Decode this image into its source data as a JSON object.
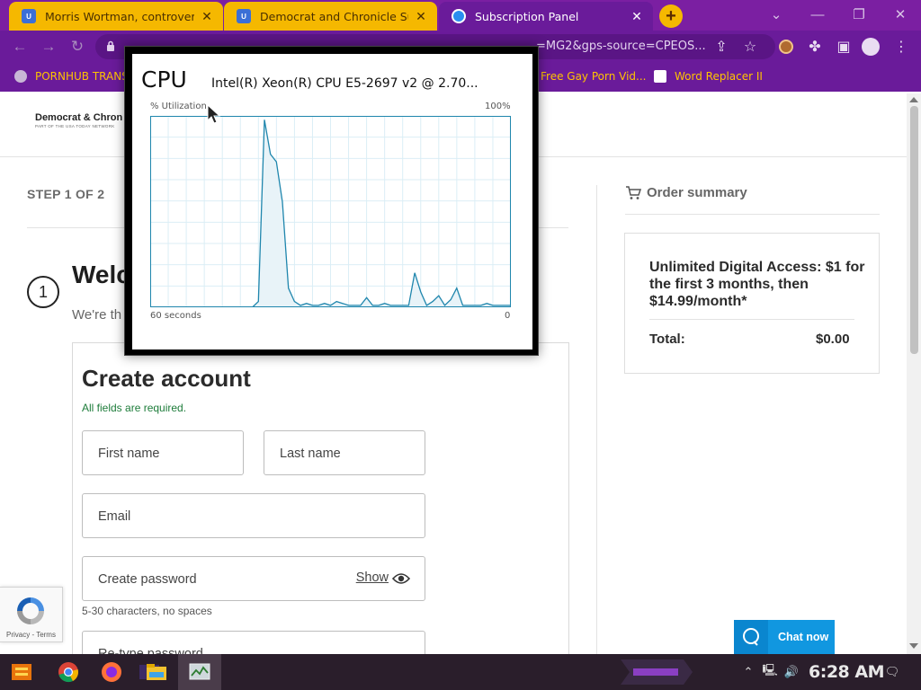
{
  "browser": {
    "tabs": [
      {
        "title": "Morris Wortman, controversial",
        "icon": "usa-today-favicon",
        "active": false
      },
      {
        "title": "Democrat and Chronicle Subsc",
        "icon": "usa-today-favicon",
        "active": false
      },
      {
        "title": "Subscription Panel",
        "icon": "globe-favicon",
        "active": true
      }
    ],
    "new_tab_label": "+",
    "close_glyph": "✕",
    "url_visible_fragment": "=MG2&gps-source=CPEOS...",
    "bookmarks": [
      {
        "label": "PORNHUB TRANS",
        "icon": "globe-icon"
      },
      {
        "label": "Free Gay Porn Vid...",
        "icon": "none"
      },
      {
        "label": "Word Replacer II",
        "icon": "wr-extension-icon"
      }
    ],
    "colors": {
      "tab_inactive": "#f5b800",
      "frame": "#6a1b9a",
      "bookmark_text": "#ffc400"
    }
  },
  "page": {
    "logo_text": "Democrat & Chron",
    "logo_sub": "PART OF THE USA TODAY NETWORK",
    "step_label": "STEP 1 OF 2",
    "step_number": "1",
    "welcome_heading": "Welc",
    "welcome_sub": "We're th",
    "form": {
      "title": "Create account",
      "required_note": "All fields are required.",
      "first_name_placeholder": "First name",
      "last_name_placeholder": "Last name",
      "email_placeholder": "Email",
      "password_placeholder": "Create password",
      "show_label": "Show",
      "password_hint": "5-30 characters, no spaces",
      "retype_placeholder": "Re-type password"
    },
    "order_summary": {
      "title": "Order summary",
      "offer": "Unlimited Digital Access: $1 for the first 3 months, then $14.99/month*",
      "total_label": "Total:",
      "total_value": "$0.00"
    },
    "recaptcha_text": "Privacy - Terms",
    "chat_label": "Chat now",
    "colors": {
      "note_green": "#1d7c3a",
      "chat_blue": "#1197e0"
    }
  },
  "cpu_widget": {
    "title": "CPU",
    "model": "Intel(R) Xeon(R) CPU E5-2697 v2 @ 2.70...",
    "y_label": "% Utilization",
    "y_max_label": "100%",
    "x_left_label": "60 seconds",
    "x_right_label": "0",
    "chart_data": {
      "type": "area",
      "title": "CPU",
      "xlabel": "60 seconds",
      "ylabel": "% Utilization",
      "xlim": [
        60,
        0
      ],
      "ylim": [
        0,
        100
      ],
      "grid": true,
      "x": [
        60,
        59,
        58,
        57,
        56,
        55,
        54,
        53,
        52,
        51,
        50,
        49,
        48,
        47,
        46,
        45,
        44,
        43,
        42,
        41,
        40,
        39,
        38,
        37,
        36,
        35,
        34,
        33,
        32,
        31,
        30,
        29,
        28,
        27,
        26,
        25,
        24,
        23,
        22,
        21,
        20,
        19,
        18,
        17,
        16,
        15,
        14,
        13,
        12,
        11,
        10,
        9,
        8,
        7,
        6,
        5,
        4,
        3,
        2,
        1,
        0
      ],
      "series": [
        {
          "values": [
            0,
            0,
            0,
            0,
            0,
            0,
            0,
            0,
            0,
            0,
            0,
            0,
            0,
            0,
            0,
            0,
            0,
            0,
            3,
            98,
            80,
            76,
            55,
            10,
            3,
            1,
            2,
            1,
            1,
            2,
            1,
            3,
            2,
            1,
            1,
            1,
            5,
            1,
            1,
            2,
            1,
            1,
            1,
            1,
            18,
            8,
            1,
            3,
            6,
            1,
            4,
            10,
            1,
            1,
            1,
            1,
            2,
            1,
            1,
            1,
            1
          ]
        }
      ],
      "colors": {
        "line": "#1f86ad",
        "fill": "#e8f3f8",
        "grid": "#dbeef6"
      }
    }
  },
  "taskbar": {
    "time": "6:28 AM",
    "items": [
      "start-icon",
      "chrome-icon",
      "firefox-icon",
      "media-player-icon",
      "file-explorer-icon",
      "task-manager-icon"
    ]
  }
}
